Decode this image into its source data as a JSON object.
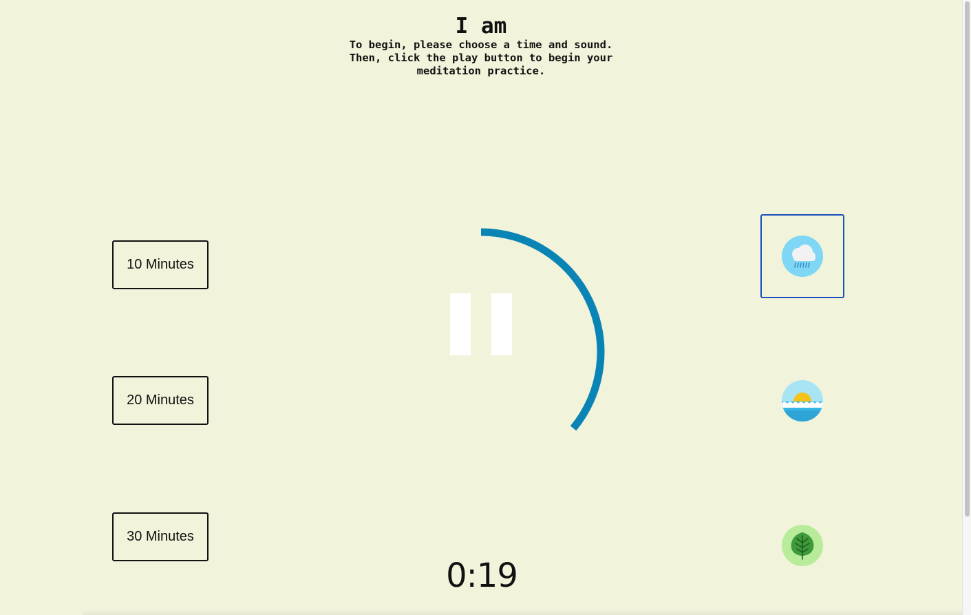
{
  "header": {
    "title": "I am",
    "instructions": "To begin, please choose a time and sound. Then, click the play button to begin your meditation practice."
  },
  "time_options": [
    {
      "label": "10 Minutes"
    },
    {
      "label": "20 Minutes"
    },
    {
      "label": "30 Minutes"
    }
  ],
  "player": {
    "state": "playing",
    "control_icon": "pause-icon",
    "progress_fraction": 0.36,
    "progress_color": "#0a84b4",
    "timer": "0:19"
  },
  "sounds": [
    {
      "name": "rain",
      "icon": "rain-cloud-icon",
      "selected": true
    },
    {
      "name": "beach",
      "icon": "sun-waves-icon",
      "selected": false
    },
    {
      "name": "forest",
      "icon": "tree-icon",
      "selected": false
    }
  ],
  "colors": {
    "background": "#f2f3db",
    "selected_border": "#1a4fbd",
    "progress": "#0a84b4"
  }
}
